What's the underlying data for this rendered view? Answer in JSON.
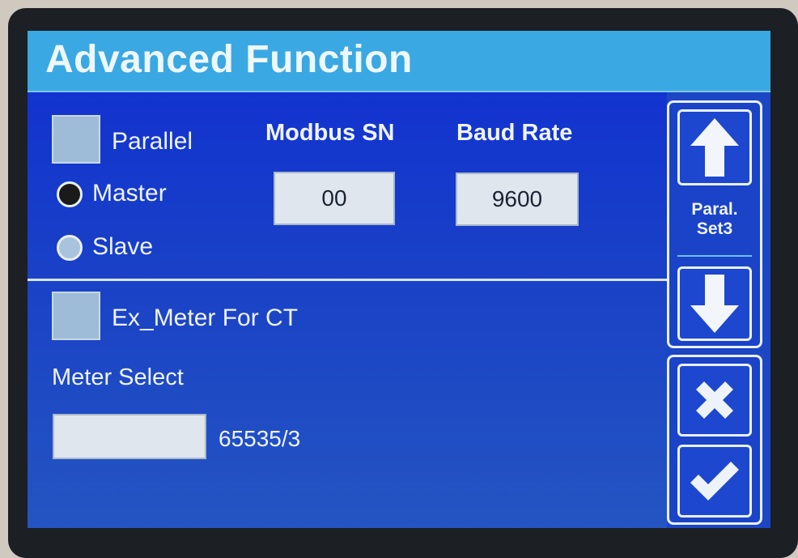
{
  "title": "Advanced Function",
  "parallel": {
    "label": "Parallel",
    "checked": false
  },
  "role": {
    "master_label": "Master",
    "master_selected": true,
    "slave_label": "Slave",
    "slave_selected": false
  },
  "modbus": {
    "label": "Modbus SN",
    "value": "00"
  },
  "baud": {
    "label": "Baud Rate",
    "value": "9600"
  },
  "ex_meter": {
    "label": "Ex_Meter For CT",
    "checked": false
  },
  "meter_select": {
    "label": "Meter Select",
    "value": "",
    "count": "65535/3"
  },
  "side": {
    "page_label_line1": "Paral.",
    "page_label_line2": "Set3",
    "icons": [
      "arrow-up-icon",
      "arrow-down-icon",
      "close-icon",
      "check-icon"
    ]
  },
  "colors": {
    "screen": "#1c46c4",
    "titlebar": "#3aa8e2",
    "field": "#dfe6ee"
  }
}
